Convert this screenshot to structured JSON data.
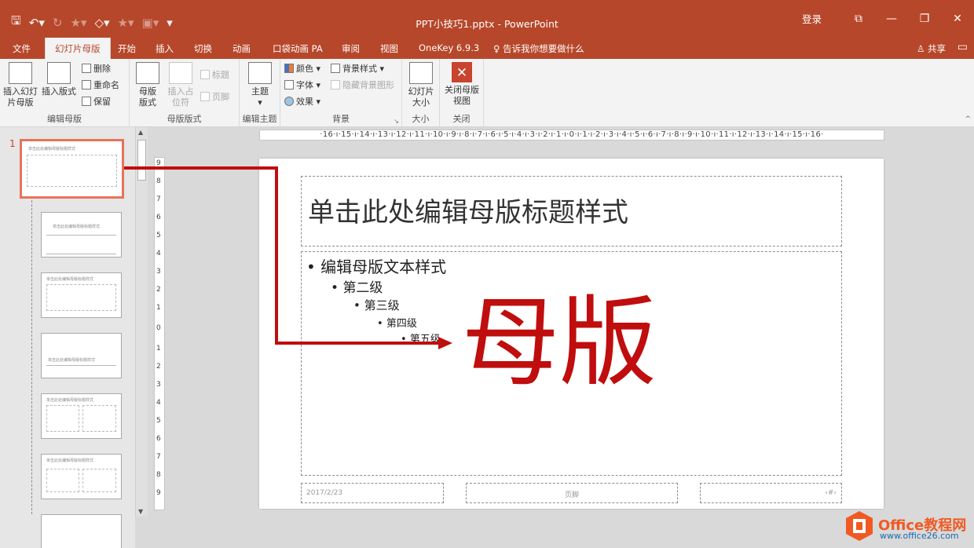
{
  "window": {
    "title": "PPT小技巧1.pptx - PowerPoint",
    "login": "登录",
    "share": "共享"
  },
  "tabs": [
    "文件",
    "幻灯片母版",
    "开始",
    "插入",
    "切换",
    "动画",
    "口袋动画 PA",
    "审阅",
    "视图",
    "OneKey 6.9.3",
    "告诉我你想要做什么"
  ],
  "ribbon": {
    "edit_master": {
      "insert_master": "插入幻灯片母版",
      "insert_layout": "插入版式",
      "delete": "删除",
      "rename": "重命名",
      "preserve": "保留",
      "label": "编辑母版"
    },
    "master_layout": {
      "master_layout_btn": "母版版式",
      "insert_placeholder": "插入占位符",
      "title_chk": "标题",
      "footer_chk": "页脚",
      "label": "母版版式"
    },
    "edit_theme": {
      "theme": "主题",
      "label": "编辑主题"
    },
    "background": {
      "colors": "颜色",
      "fonts": "字体",
      "effects": "效果",
      "bg_styles": "背景样式",
      "hide_bg": "隐藏背景图形",
      "label": "背景"
    },
    "size": {
      "slide_size": "幻灯片大小",
      "label": "大小"
    },
    "close": {
      "close_master": "关闭母版视图",
      "label": "关闭"
    }
  },
  "thumbnails": {
    "first_number": "1",
    "thumb_title": "单击此处编辑母版标题样式"
  },
  "ruler": {
    "h": "·16·ı·15·ı·14·ı·13·ı·12·ı·11·ı·10·ı·9·ı·8·ı·7·ı·6·ı·5·ı·4·ı·3·ı·2·ı·1·ı·0·ı·1·ı·2·ı·3·ı·4·ı·5·ı·6·ı·7·ı·8·ı·9·ı·10·ı·11·ı·12·ı·13·ı·14·ı·15·ı·16·",
    "v": [
      "9",
      "8",
      "7",
      "6",
      "5",
      "4",
      "3",
      "2",
      "1",
      "0",
      "1",
      "2",
      "3",
      "4",
      "5",
      "6",
      "7",
      "8",
      "9"
    ]
  },
  "slide": {
    "title": "单击此处编辑母版标题样式",
    "bullets": [
      "编辑母版文本样式",
      "第二级",
      "第三级",
      "第四级",
      "第五级"
    ],
    "footer_date": "2017/2/23",
    "footer_center": "页脚",
    "footer_num": "‹#›"
  },
  "annotation": {
    "text": "母版",
    "color": "#c00d0d"
  },
  "watermark": {
    "brand": "Office教程网",
    "url": "www.office26.com"
  },
  "colors": {
    "accent": "#b7472a"
  }
}
